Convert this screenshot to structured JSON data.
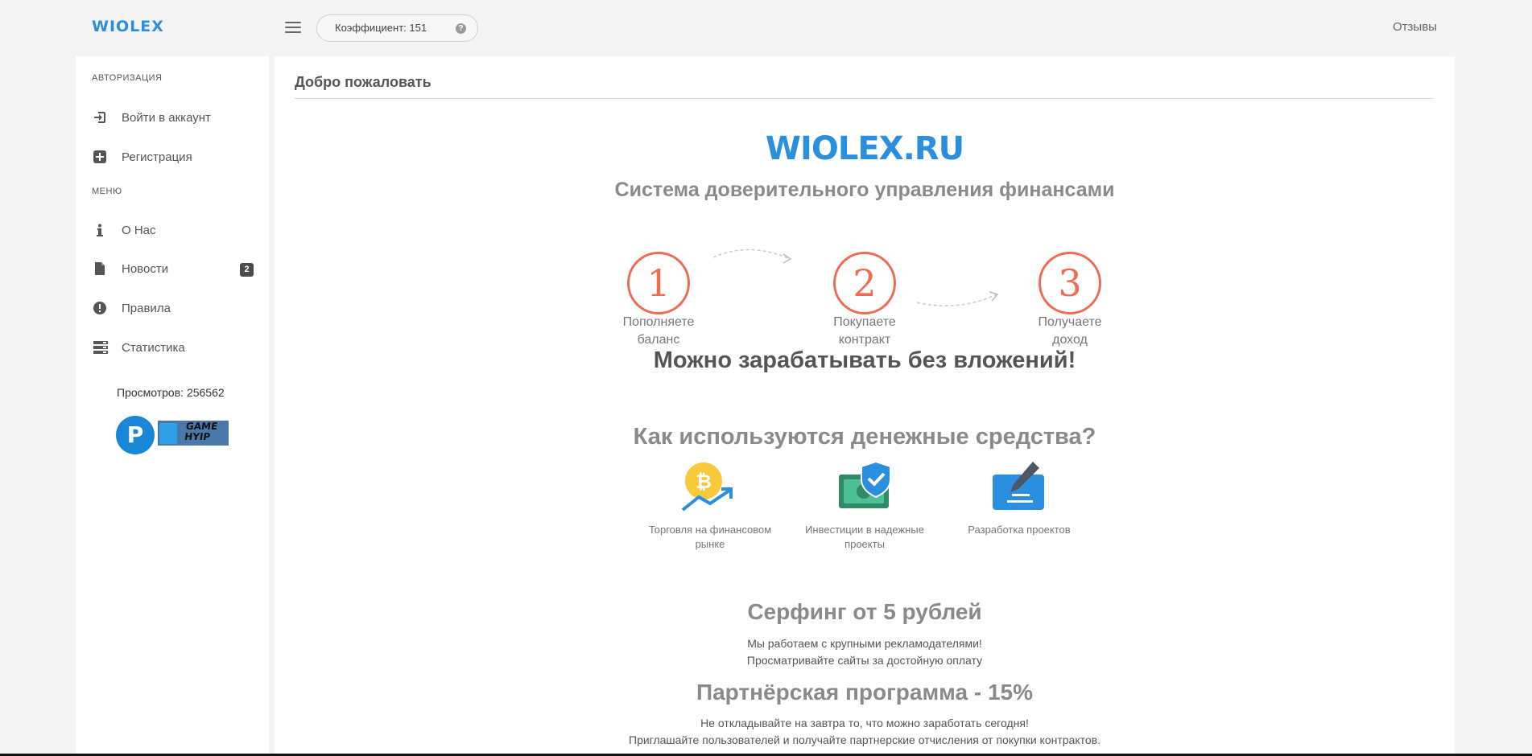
{
  "header": {
    "brand": "WIOLEX",
    "coefficient_label": "Коэффициент: 151",
    "help_icon": "?",
    "reviews_link": "Отзывы"
  },
  "sidebar": {
    "auth_section": "Авторизация",
    "menu_section": "Меню",
    "auth_items": [
      {
        "label": "Войти в аккаунт",
        "icon": "sign-in-icon"
      },
      {
        "label": "Регистрация",
        "icon": "plus-square-icon"
      }
    ],
    "menu_items": [
      {
        "label": "О Нас",
        "icon": "info-icon"
      },
      {
        "label": "Новости",
        "icon": "file-icon",
        "badge": "2"
      },
      {
        "label": "Правила",
        "icon": "exclamation-circle-icon"
      },
      {
        "label": "Статистика",
        "icon": "server-icon"
      }
    ],
    "views": "Просмотров: 256562",
    "counter_letter": "P",
    "counter_text": "GAME HYIP"
  },
  "main": {
    "title": "Добро пожаловать",
    "logo": "WIOLEX.RU",
    "tagline": "Система доверительного управления финансами",
    "steps": [
      {
        "number": "1",
        "label_line1": "Пополняете",
        "label_line2": "баланс"
      },
      {
        "number": "2",
        "label_line1": "Покупаете",
        "label_line2": "контракт"
      },
      {
        "number": "3",
        "label_line1": "Получаете",
        "label_line2": "доход"
      }
    ],
    "earn_headline": "Можно зарабатывать без вложений!",
    "how_title": "Как используются денежные средства?",
    "uses": [
      {
        "label_line1": "Торговля на финансовом",
        "label_line2": "рынке",
        "icon": "bitcoin-chart-icon"
      },
      {
        "label_line1": "Инвестиции в надежные",
        "label_line2": "проекты",
        "icon": "money-shield-icon"
      },
      {
        "label_line1": "Разработка проектов",
        "label_line2": "",
        "icon": "pen-board-icon"
      }
    ],
    "surfing_title": "Серфинг от 5 рублей",
    "surfing_line1": "Мы работаем с крупными рекламодателями!",
    "surfing_line2": "Просматривайте сайты за достойную оплату",
    "partner_title": "Партнёрская программа - 15%",
    "partner_line1": "Не откладывайте на завтра то, что можно заработать сегодня!",
    "partner_line2": "Приглашайте пользователей и получайте партнерские отчисления от покупки контрактов."
  },
  "colors": {
    "brand_blue": "#2b8fe0",
    "step_orange": "#ec6d51",
    "badge_dark": "#4a4a4a"
  }
}
